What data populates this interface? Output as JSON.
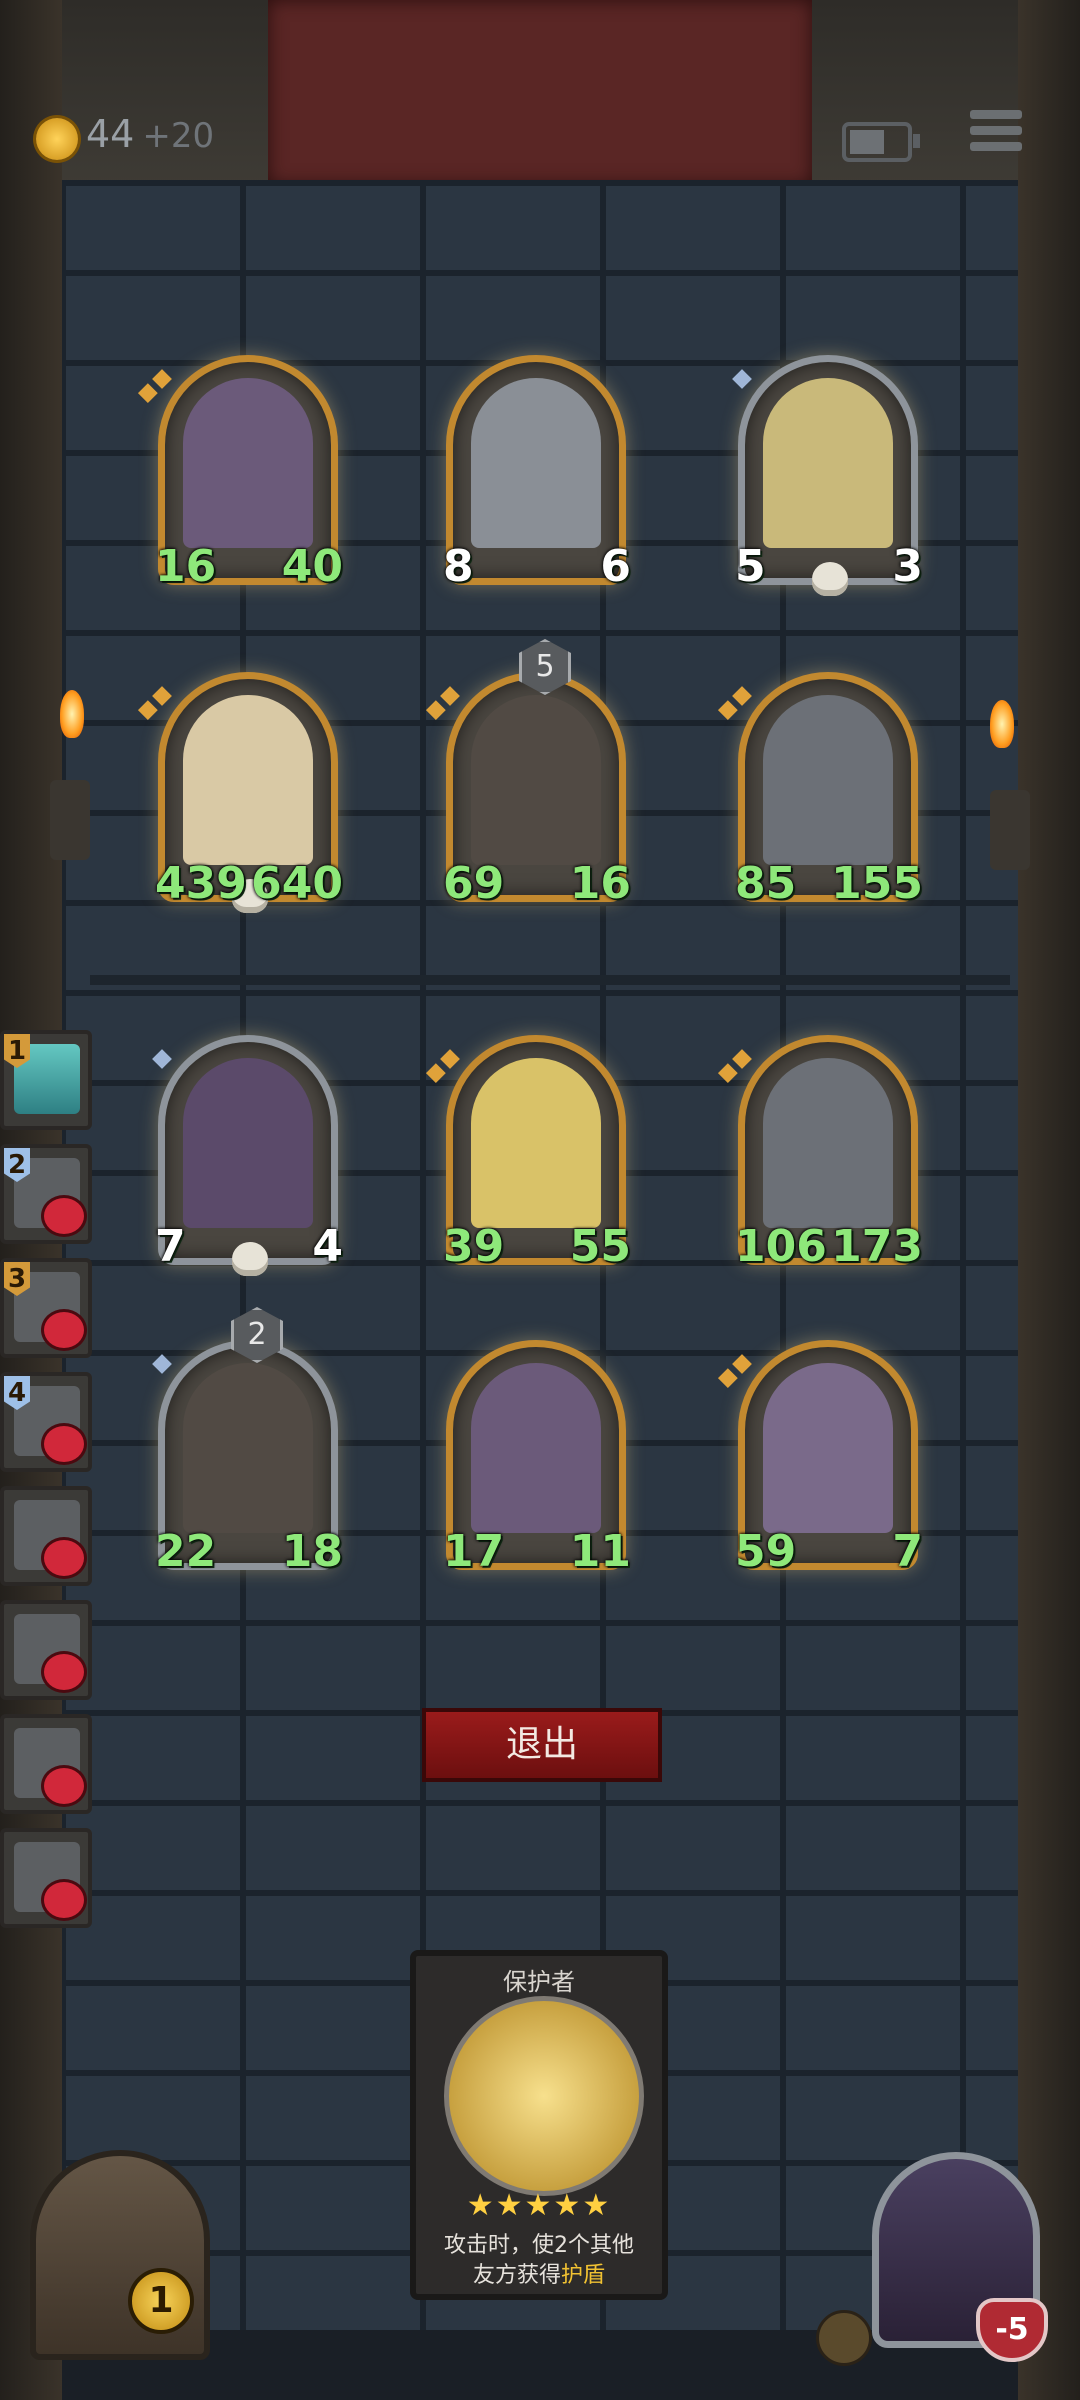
{
  "hud": {
    "gold": "44",
    "gold_bonus": "+20",
    "coin_icon": "crown-coin-icon",
    "battery_icon": "battery-icon",
    "menu_icon": "hamburger-menu-icon"
  },
  "board": {
    "units": [
      {
        "atk": "16",
        "hp": "40",
        "frame": "gold",
        "tier": 2
      },
      {
        "atk": "8",
        "hp": "6",
        "frame": "gold",
        "tier": 0,
        "atk_white": true,
        "hp_white": true
      },
      {
        "atk": "5",
        "hp": "3",
        "frame": "silver",
        "tier": 1,
        "atk_white": true,
        "hp_white": true,
        "skull": true
      },
      {
        "atk": "439",
        "hp": "640",
        "frame": "gold",
        "tier": 2,
        "skull": true
      },
      {
        "atk": "69",
        "hp": "16",
        "frame": "gold",
        "tier": 2,
        "badge": "5"
      },
      {
        "atk": "85",
        "hp": "155",
        "frame": "gold",
        "tier": 3
      },
      {
        "atk": "7",
        "hp": "4",
        "frame": "silver",
        "tier": 1,
        "atk_white": true,
        "hp_white": true,
        "skull": true
      },
      {
        "atk": "39",
        "hp": "55",
        "frame": "gold",
        "tier": 3
      },
      {
        "atk": "106",
        "hp": "173",
        "frame": "gold",
        "tier": 3
      },
      {
        "atk": "22",
        "hp": "18",
        "frame": "silver",
        "tier": 1,
        "badge": "2"
      },
      {
        "atk": "17",
        "hp": "11",
        "frame": "gold",
        "tier": 0
      },
      {
        "atk": "59",
        "hp": "7",
        "frame": "gold",
        "tier": 2
      }
    ]
  },
  "roster": {
    "slots": [
      {
        "num": "1",
        "state": "alive"
      },
      {
        "num": "2",
        "state": "dead"
      },
      {
        "num": "3",
        "state": "dead"
      },
      {
        "num": "4",
        "state": "dead"
      },
      {
        "num": "",
        "state": "dead"
      },
      {
        "num": "",
        "state": "dead"
      },
      {
        "num": "",
        "state": "dead"
      },
      {
        "num": "",
        "state": "dead"
      }
    ]
  },
  "exit_button": {
    "label": "退出"
  },
  "card": {
    "name": "保护者",
    "stars": "★★★★★",
    "desc_line1": "攻击时，使2个其他",
    "desc_line2_prefix": "友方获得",
    "desc_keyword": "护盾"
  },
  "chest": {
    "count": "1"
  },
  "boss": {
    "hp": "-5"
  }
}
